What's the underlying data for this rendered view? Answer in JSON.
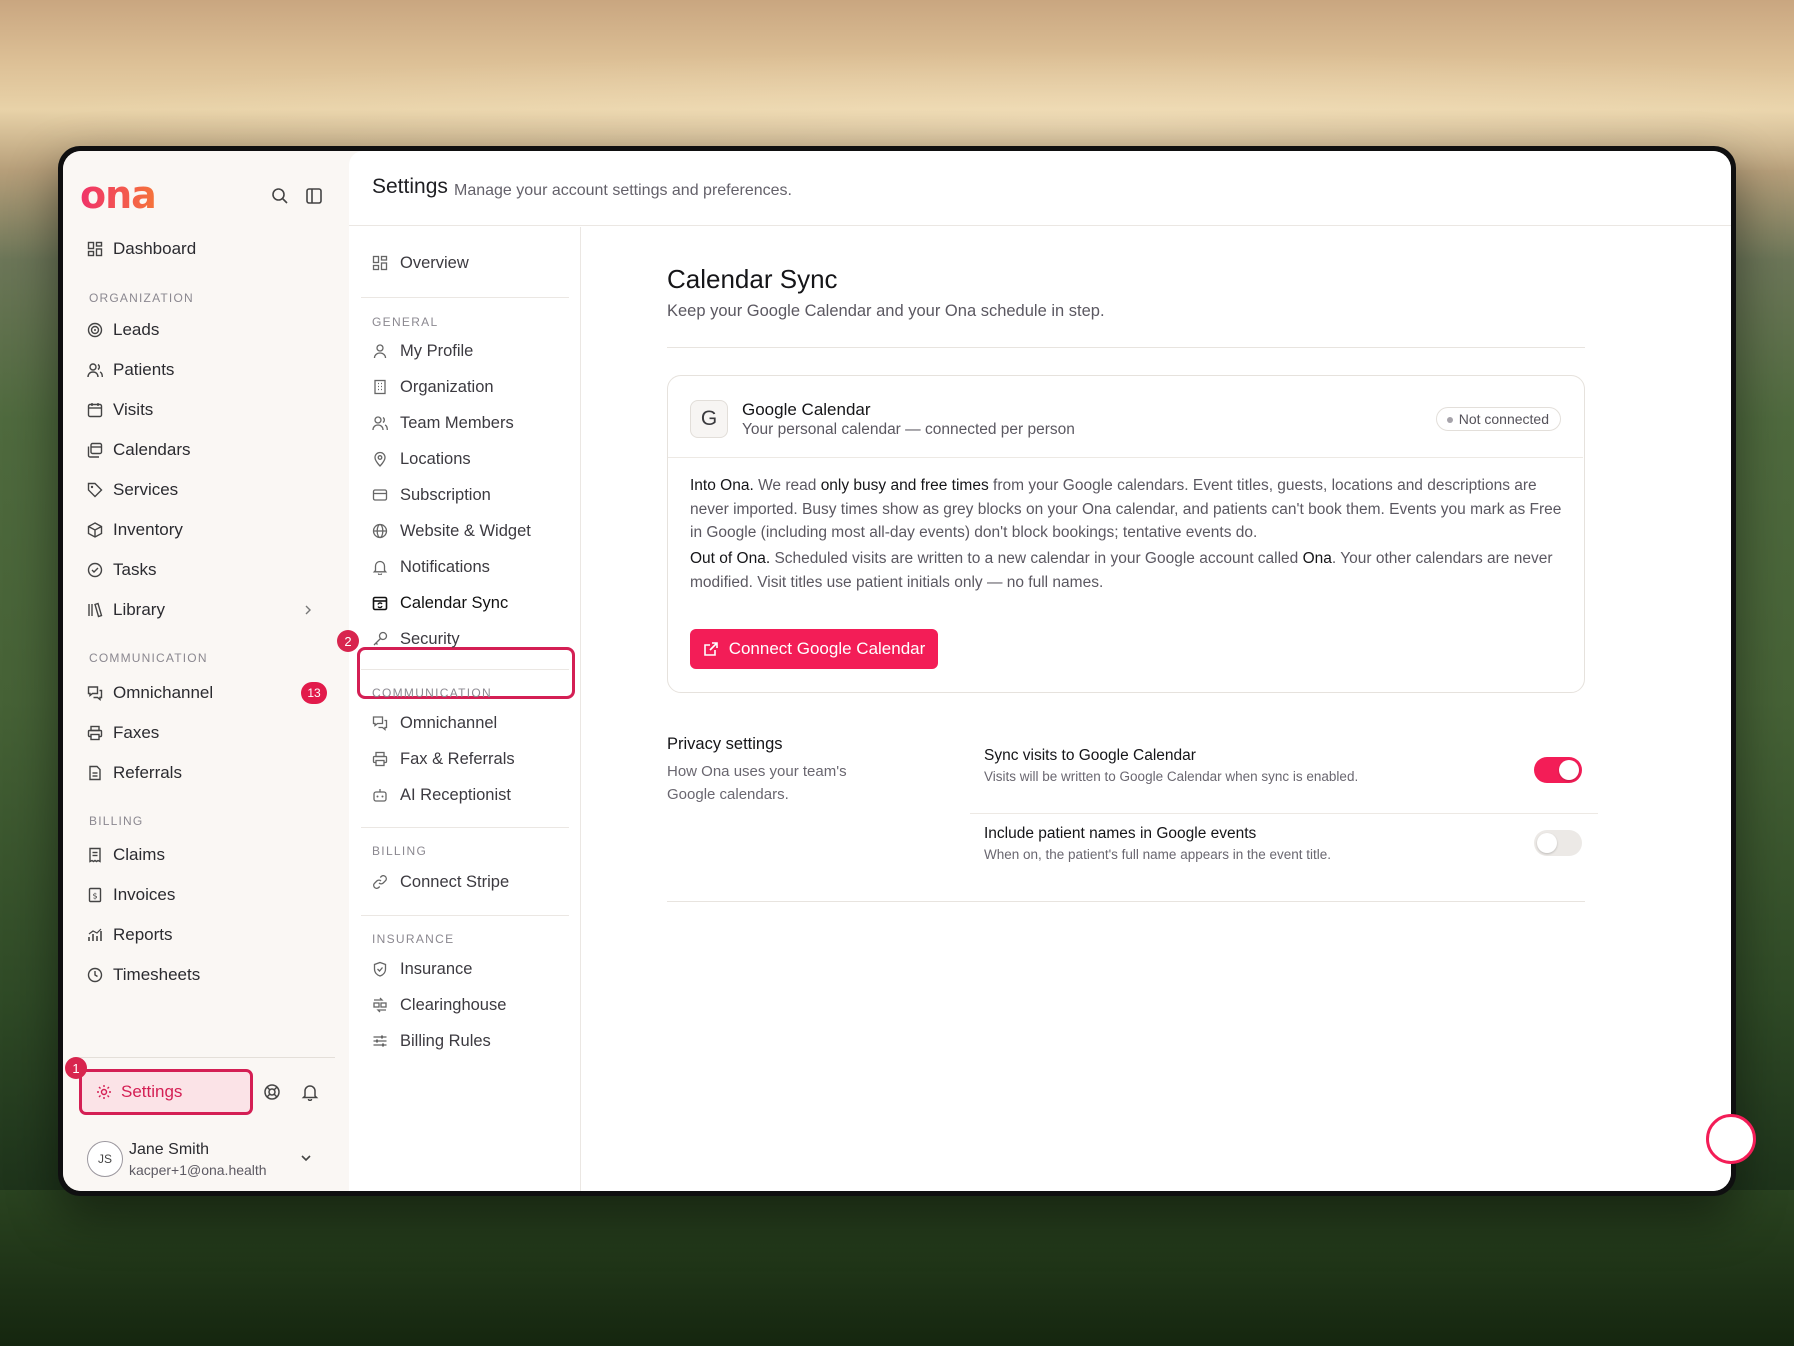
{
  "app": {
    "logo": "ona"
  },
  "sidebar": {
    "dashboard": "Dashboard",
    "sections": {
      "organization": "ORGANIZATION",
      "communication": "COMMUNICATION",
      "billing": "BILLING"
    },
    "org_items": [
      "Leads",
      "Patients",
      "Visits",
      "Calendars",
      "Services",
      "Inventory",
      "Tasks",
      "Library"
    ],
    "comm_items": [
      "Omnichannel",
      "Faxes",
      "Referrals"
    ],
    "omnichannel_badge": "13",
    "billing_items": [
      "Claims",
      "Invoices",
      "Reports",
      "Timesheets"
    ],
    "settings": "Settings",
    "settings_marker": "1",
    "user": {
      "initials": "JS",
      "name": "Jane Smith",
      "email": "kacper+1@ona.health"
    }
  },
  "header": {
    "title": "Settings",
    "subtitle": "Manage your account settings and preferences."
  },
  "subnav": {
    "overview": "Overview",
    "general_label": "GENERAL",
    "general": [
      "My Profile",
      "Organization",
      "Team Members",
      "Locations",
      "Subscription",
      "Website & Widget",
      "Notifications",
      "Calendar Sync",
      "Security"
    ],
    "active_marker": "2",
    "communication_label": "COMMUNICATION",
    "communication": [
      "Omnichannel",
      "Fax & Referrals",
      "AI Receptionist"
    ],
    "billing_label": "BILLING",
    "billing": [
      "Connect Stripe"
    ],
    "insurance_label": "INSURANCE",
    "insurance": [
      "Insurance",
      "Clearinghouse",
      "Billing Rules"
    ]
  },
  "content": {
    "title": "Calendar Sync",
    "subtitle": "Keep your Google Calendar and your Ona schedule in step.",
    "card": {
      "icon_letter": "G",
      "title": "Google Calendar",
      "subtitle": "Your personal calendar — connected per person",
      "status": "Not connected",
      "into_lead": "Into Ona.",
      "into_1": " We read ",
      "into_bold": "only busy and free times",
      "into_2": " from your Google calendars. Event titles, guests, locations and descriptions are never imported. Busy times show as grey blocks on your Ona calendar, and patients can't book them. Events you mark as Free in Google (including most all-day events) don't block bookings; tentative events do.",
      "out_lead": "Out of Ona.",
      "out_1": " Scheduled visits are written to a new calendar in your Google account called ",
      "out_bold": "Ona",
      "out_2": ". Your other calendars are never modified. Visit titles use patient initials only — no full names.",
      "button": "Connect Google Calendar"
    },
    "privacy": {
      "title": "Privacy settings",
      "subtitle": "How Ona uses your team's Google calendars.",
      "settings": [
        {
          "title": "Sync visits to Google Calendar",
          "desc": "Visits will be written to Google Calendar when sync is enabled.",
          "enabled": true
        },
        {
          "title": "Include patient names in Google events",
          "desc": "When on, the patient's full name appears in the event title.",
          "enabled": false
        }
      ]
    }
  },
  "colors": {
    "accent": "#F31D57",
    "highlight": "#D41F54"
  }
}
